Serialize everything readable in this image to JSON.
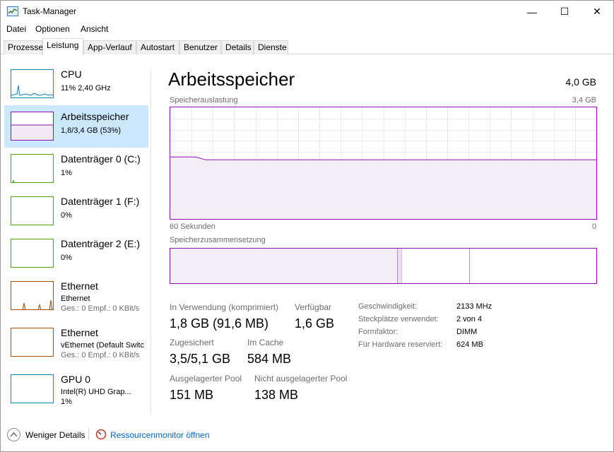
{
  "window": {
    "title": "Task-Manager",
    "icon": "task-manager-icon",
    "controls": {
      "minimize": "—",
      "maximize": "☐",
      "close": "✕"
    }
  },
  "menu": {
    "file": "Datei",
    "options": "Optionen",
    "view": "Ansicht"
  },
  "tabs": [
    {
      "label": "Prozesse"
    },
    {
      "label": "Leistung"
    },
    {
      "label": "App-Verlauf"
    },
    {
      "label": "Autostart"
    },
    {
      "label": "Benutzer"
    },
    {
      "label": "Details"
    },
    {
      "label": "Dienste"
    }
  ],
  "sidebar": {
    "items": [
      {
        "title": "CPU",
        "sub1": "11% 2,40 GHz",
        "color": "#1b86b6"
      },
      {
        "title": "Arbeitsspeicher",
        "sub1": "1,8/3,4 GB (53%)",
        "color": "#8b12ae"
      },
      {
        "title": "Datenträger 0 (C:)",
        "sub1": "1%",
        "color": "#4da60c"
      },
      {
        "title": "Datenträger 1 (F:)",
        "sub1": "0%",
        "color": "#4da60c"
      },
      {
        "title": "Datenträger 2 (E:)",
        "sub1": "0%",
        "color": "#4da60c"
      },
      {
        "title": "Ethernet",
        "sub1": "Ethernet",
        "sub2": "Ges.: 0 Empf.: 0 KBit/s",
        "color": "#a74f01"
      },
      {
        "title": "Ethernet",
        "sub1": "vEthernet (Default Switc",
        "sub2": "Ges.: 0 Empf.: 0 KBit/s",
        "color": "#a74f01"
      },
      {
        "title": "GPU 0",
        "sub1": "Intel(R) UHD Grap...",
        "sub2": "1%",
        "color": "#1b86b6"
      }
    ]
  },
  "main": {
    "title": "Arbeitsspeicher",
    "total": "4,0 GB",
    "usage_label": "Speicherauslastung",
    "usage_max": "3,4 GB",
    "time_left": "60 Sekunden",
    "time_right": "0",
    "composition_label": "Speicherzusammensetzung",
    "usage_fraction": 0.53,
    "stats": {
      "in_use_label": "In Verwendung (komprimiert)",
      "in_use_value": "1,8 GB (91,6 MB)",
      "available_label": "Verfügbar",
      "available_value": "1,6 GB",
      "committed_label": "Zugesichert",
      "committed_value": "3,5/5,1 GB",
      "cache_label": "Im Cache",
      "cache_value": "584 MB",
      "paged_label": "Ausgelagerter Pool",
      "paged_value": "151 MB",
      "nonpaged_label": "Nicht ausgelagerter Pool",
      "nonpaged_value": "138 MB"
    },
    "details": [
      {
        "key": "Geschwindigkeit:",
        "value": "2133 MHz"
      },
      {
        "key": "Steckplätze verwendet:",
        "value": "2 von 4"
      },
      {
        "key": "Formfaktor:",
        "value": "DIMM"
      },
      {
        "key": "Für Hardware reserviert:",
        "value": "624 MB"
      }
    ]
  },
  "footer": {
    "fewer_details": "Weniger Details",
    "resource_monitor": "Ressourcenmonitor öffnen"
  },
  "colors": {
    "accent_memory": "#8b12ae",
    "selected_bg": "#cce8ff",
    "link": "#0066cc"
  }
}
